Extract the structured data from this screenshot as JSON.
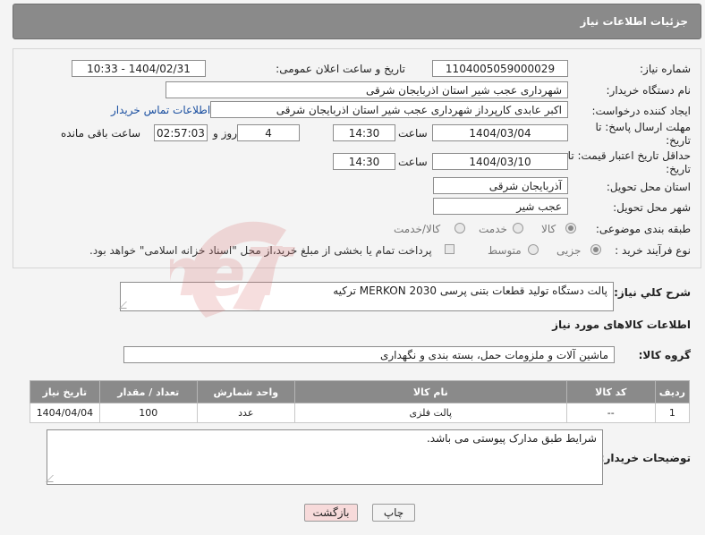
{
  "header": {
    "title": "جزئیات اطلاعات نیاز"
  },
  "fields": {
    "need_number_label": "شماره نیاز:",
    "need_number": "1104005059000029",
    "announce_label": "تاریخ و ساعت اعلان عمومی:",
    "announce_value": "1404/02/31 - 10:33",
    "buyer_org_label": "نام دستگاه خریدار:",
    "buyer_org": "شهرداری عجب شیر استان اذربایجان شرقی",
    "creator_label": "ایجاد کننده درخواست:",
    "creator": "اکبر عابدی کارپرداز شهرداری عجب شیر استان اذربایجان شرقی",
    "contact_link": "اطلاعات تماس خریدار",
    "deadline_label": "مهلت ارسال پاسخ: تا تاریخ:",
    "deadline_date": "1404/03/04",
    "time_label": "ساعت",
    "deadline_time": "14:30",
    "days_value": "4",
    "days_label": "روز و",
    "remaining_time": "02:57:03",
    "remaining_label": "ساعت باقی مانده",
    "validity_label": "حداقل تاریخ اعتبار قیمت: تا تاریخ:",
    "validity_date": "1404/03/10",
    "validity_time": "14:30",
    "province_label": "استان محل تحویل:",
    "province": "آذربایجان شرقی",
    "city_label": "شهر محل تحویل:",
    "city": "عجب شیر",
    "category_label": "طبقه بندی موضوعی:",
    "category_options": [
      "کالا",
      "خدمت",
      "کالا/خدمت"
    ],
    "process_label": "نوع فرآیند خرید :",
    "process_options": [
      "جزیی",
      "متوسط"
    ],
    "payment_note": "پرداخت تمام یا بخشی از مبلغ خرید،از محل \"اسناد خزانه اسلامی\" خواهد بود."
  },
  "description": {
    "label": "شرح کلي نياز:",
    "text": "پالت دستگاه تولید قطعات بتنی پرسی MERKON 2030  ترکیه"
  },
  "goods": {
    "section_title": "اطلاعات کالاهای مورد نیاز",
    "group_label": "گروه کالا:",
    "group_value": "ماشین آلات و ملزومات حمل، بسته بندی و نگهداری",
    "columns": [
      "ردیف",
      "کد کالا",
      "نام کالا",
      "واحد شمارش",
      "تعداد / مقدار",
      "تاریخ نیاز"
    ],
    "rows": [
      {
        "row": "1",
        "code": "--",
        "name": "پالت فلزی",
        "unit": "عدد",
        "qty": "100",
        "date": "1404/04/04"
      }
    ]
  },
  "buyer_notes": {
    "label": "توضیحات خریدار:",
    "text": "شرایط طبق مدارک پیوستی می باشد."
  },
  "buttons": {
    "print": "چاپ",
    "back": "بازگشت"
  },
  "watermark": {
    "text": "AriaTender.neT"
  },
  "colors": {
    "header_bg": "#8a8a8a",
    "link": "#1a4fa0",
    "back_btn": "#f7dada",
    "watermark": "#d86b6b"
  }
}
